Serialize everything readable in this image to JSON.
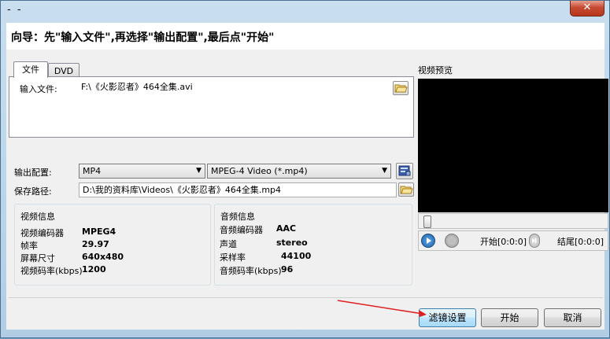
{
  "window": {
    "title": "- -",
    "close_glyph": "✕"
  },
  "wizard": {
    "text": "向导：先\"输入文件\",再选择\"输出配置\",最后点\"开始\""
  },
  "tabs": [
    {
      "label": "文件"
    },
    {
      "label": "DVD"
    }
  ],
  "input_file": {
    "label": "输入文件:",
    "value": "F:\\《火影忍者》464全集.avi",
    "icon": "folder-open-icon"
  },
  "output_config": {
    "label": "输出配置:",
    "format": "MP4",
    "preset": "MPEG-4 Video (*.mp4)",
    "icon": "settings-icon"
  },
  "save_path": {
    "label": "保存路径:",
    "value": "D:\\我的资料库\\Videos\\《火影忍者》464全集.mp4",
    "icon": "folder-open-icon"
  },
  "video_info": {
    "title": "视频信息",
    "rows": [
      {
        "label": "视频编码器",
        "value": "MPEG4"
      },
      {
        "label": "帧率",
        "value": "29.97"
      },
      {
        "label": "屏幕尺寸",
        "value": "640x480"
      },
      {
        "label": "视频码率(kbps)",
        "value": "1200"
      }
    ]
  },
  "audio_info": {
    "title": "音频信息",
    "rows": [
      {
        "label": "音频编码器",
        "value": "AAC"
      },
      {
        "label": "声道",
        "value": "stereo"
      },
      {
        "label": "采样率",
        "value": "44100"
      },
      {
        "label": "音频码率(kbps)",
        "value": "96"
      }
    ]
  },
  "preview": {
    "label": "视频预览",
    "start_label": "开始[0:0:0]",
    "end_label": "结尾[0:0:0]",
    "icons": [
      "play-icon",
      "stop-icon",
      "next-icon"
    ]
  },
  "buttons": {
    "filter": "滤镜设置",
    "start": "开始",
    "cancel": "取消"
  },
  "colors": {
    "title_gradient": "#b2cde3",
    "preview_bg": "#000000",
    "annotation_arrow": "#e02020",
    "focus_blue": "#3c7fb1"
  }
}
